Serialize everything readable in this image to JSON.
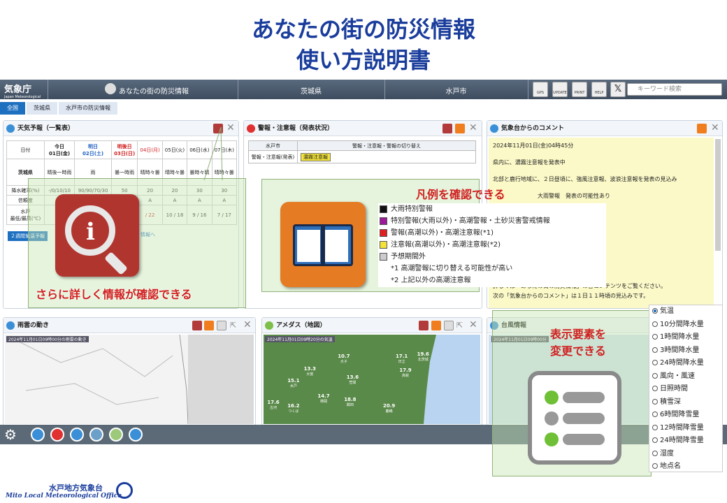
{
  "title_line1": "あなたの街の防災情報",
  "title_line2": "使い方説明書",
  "header": {
    "logo": "気象庁",
    "logo_sub": "Japan Meteorological Agency",
    "nav1": "あなたの街の防災情報",
    "nav2": "茨城県",
    "nav3": "水戸市",
    "btn_gps": "GPS",
    "btn_update": "UPDATE",
    "btn_print": "PRINT",
    "btn_help": "HELP",
    "search_placeholder": "キーワード検索"
  },
  "breadcrumb": [
    "全国",
    "茨城県",
    "水戸市の防災情報"
  ],
  "weather": {
    "title": "天気予報（一覧表）",
    "date_col": "日付",
    "days": [
      "今日\n01日(金)",
      "明日\n02日(土)",
      "明後日\n03日(日)",
      "04日(月)",
      "05日(火)",
      "06日(水)",
      "07日(木)"
    ],
    "region": "茨城県",
    "weathers": [
      "晴後一時雨",
      "雨",
      "曇一時雨",
      "晴時々曇",
      "晴時々曇",
      "曇時々晴",
      "晴時々曇"
    ],
    "row_rain": "降水確率(%)",
    "row_rel": "信頼度",
    "row_temp": "水戸",
    "row_temp2": "最低/最高(℃)",
    "rain_vals": [
      "-/0/10/10",
      "90/90/70/30",
      "50",
      "20",
      "20",
      "30",
      "30"
    ],
    "temps": [
      "",
      "",
      "",
      "",
      "10 / 18",
      "9 / 16",
      "7 / 17"
    ],
    "temp_partial": "/ 22",
    "link1": "２週間気温予報",
    "link2": "情報へ"
  },
  "warn": {
    "title": "警報・注意報（発表状況）",
    "city": "水戸市",
    "switch_label": "警報・注意報・警報の切り替え",
    "row_label": "警報・注意報(発表)",
    "badge": "濃霧注意報"
  },
  "comment": {
    "title": "気象台からのコメント",
    "date": "2024年11月01日(金)04時45分",
    "line1": "県内に、濃霧注意報を発表中",
    "line2": "北部と鹿行地域に、２日昼頃に、強風注意報、波浪注意報を発表の見込み",
    "line3": "大雨警報　発表の可能性あり",
    "line4": "詳しくは「あなたの街の防災情報」の各コンテンツをご覧ください。",
    "line5": "次の「気象台からのコメント」は１日１１時頃の見込みです。"
  },
  "legend": {
    "callout": "凡例を確認できる",
    "items": [
      "大雨特別警報",
      "特別警報(大雨以外)・高潮警報・土砂災害警戒情報",
      "警報(高潮以外)・高潮注意報(*1)",
      "注意報(高潮以外)・高潮注意報(*2)",
      "予想期間外"
    ],
    "colors": [
      "#111111",
      "#9b1b9b",
      "#e02020",
      "#f2e23a",
      "#cccccc"
    ],
    "note1": "*1 高潮警報に切り替える可能性が高い",
    "note2": "*2 上記以外の高潮注意報"
  },
  "info_callout": "さらに詳しく情報が確認できる",
  "rain": {
    "title": "雨雲の動き",
    "stamp": "2024年11月01日09時00分の雨雲の動き"
  },
  "amedas": {
    "title": "アメダス（地図）",
    "stamp": "2024年11月01日09時20分の気温",
    "values": [
      {
        "v": "10.7",
        "n": "大子"
      },
      {
        "v": "17.1",
        "n": "日立"
      },
      {
        "v": "19.6",
        "n": "北茨城"
      },
      {
        "v": "13.3",
        "n": "大宮"
      },
      {
        "v": "17.9",
        "n": "高萩"
      },
      {
        "v": "13.6",
        "n": "笠間"
      },
      {
        "v": "15.1",
        "n": "水戸"
      },
      {
        "v": "14.7",
        "n": "柿岡"
      },
      {
        "v": "18.8",
        "n": "鉾田"
      },
      {
        "v": "17.6",
        "n": "古河"
      },
      {
        "v": "16.2",
        "n": "つくば"
      },
      {
        "v": "20.9",
        "n": "鹿嶋"
      }
    ]
  },
  "typhoon": {
    "title": "台風情報",
    "stamp": "2024年11月01日09時00分"
  },
  "elements": {
    "callout_line1": "表示要素を",
    "callout_line2": "変更できる",
    "items": [
      "気温",
      "10分間降水量",
      "1時間降水量",
      "3時間降水量",
      "24時間降水量",
      "風向・風速",
      "日照時間",
      "積雪深",
      "6時間降雪量",
      "12時間降雪量",
      "24時間降雪量",
      "湿度",
      "地点名"
    ],
    "selected": 0
  },
  "footer": {
    "name_jp": "水戸地方気象台",
    "name_en": "Mito Local Meteorological Office"
  }
}
